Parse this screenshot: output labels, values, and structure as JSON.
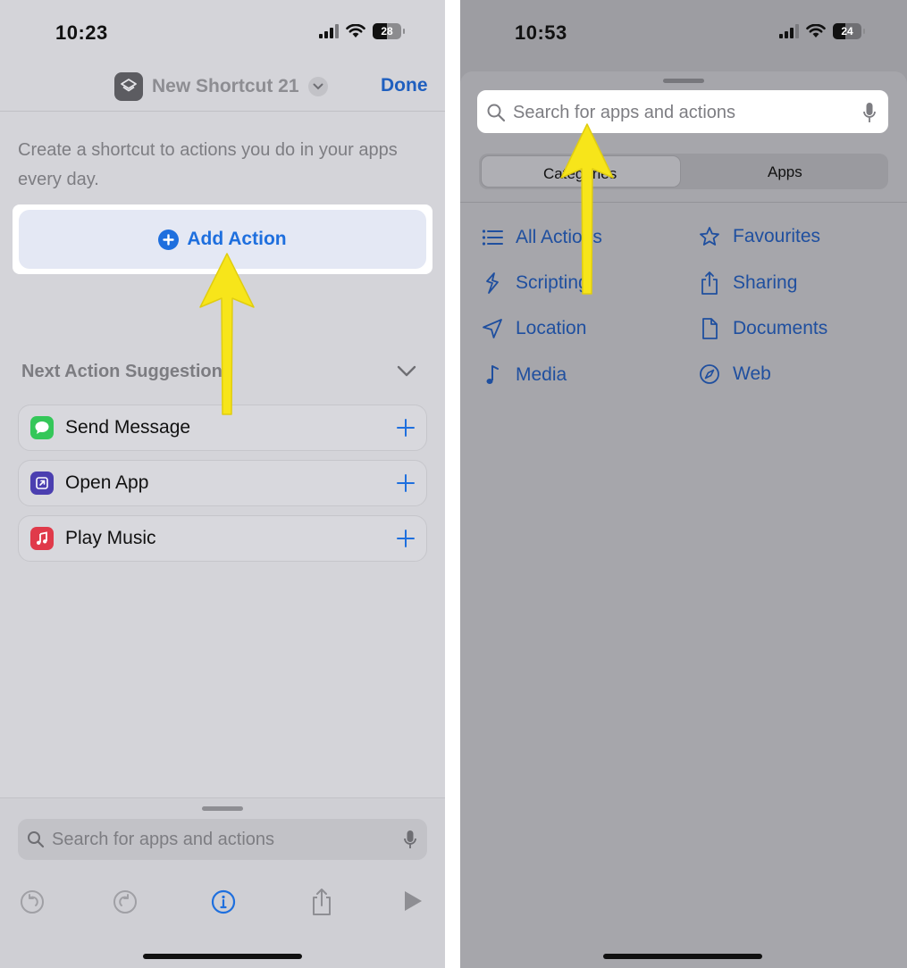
{
  "left_screen": {
    "status": {
      "time": "10:23",
      "battery": "28"
    },
    "nav": {
      "title": "New Shortcut 21",
      "done_label": "Done"
    },
    "intro_text": "Create a shortcut to actions you do in your apps every day.",
    "add_action_label": "Add Action",
    "suggestions": {
      "header": "Next Action Suggestions",
      "items": [
        {
          "label": "Send Message",
          "icon": "messages-icon",
          "color": "#34c759"
        },
        {
          "label": "Open App",
          "icon": "open-app-icon",
          "color": "#4b3fb0"
        },
        {
          "label": "Play Music",
          "icon": "music-icon",
          "color": "#e03a4a"
        }
      ]
    },
    "search": {
      "placeholder": "Search for apps and actions"
    },
    "toolbar": [
      "undo-icon",
      "redo-icon",
      "info-icon",
      "share-icon",
      "play-icon"
    ]
  },
  "right_screen": {
    "status": {
      "time": "10:53",
      "battery": "24"
    },
    "search": {
      "placeholder": "Search for apps and actions"
    },
    "segments": [
      "Categories",
      "Apps"
    ],
    "categories": [
      {
        "label": "All Actions",
        "icon": "list-icon"
      },
      {
        "label": "Favourites",
        "icon": "star-icon"
      },
      {
        "label": "Scripting",
        "icon": "scripting-icon"
      },
      {
        "label": "Sharing",
        "icon": "share-icon"
      },
      {
        "label": "Location",
        "icon": "location-icon"
      },
      {
        "label": "Documents",
        "icon": "document-icon"
      },
      {
        "label": "Media",
        "icon": "music-note-icon"
      },
      {
        "label": "Web",
        "icon": "compass-icon"
      }
    ]
  },
  "colors": {
    "accent": "#1e6fde",
    "arrow": "#f7e51a",
    "link": "#1f4f9f"
  }
}
